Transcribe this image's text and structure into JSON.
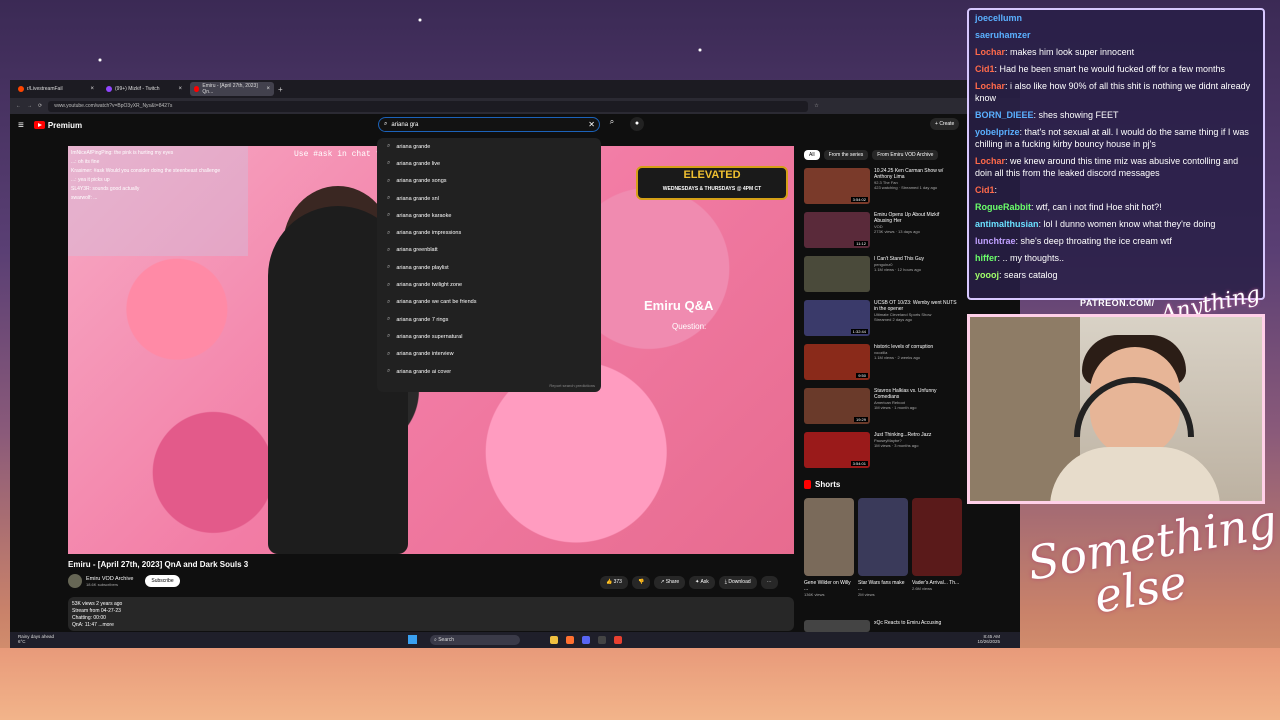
{
  "browser": {
    "tabs": [
      {
        "label": "r/LivestreamFail",
        "color": "#ff4500"
      },
      {
        "label": "(99+) Mizkif - Twitch",
        "color": "#9146ff"
      },
      {
        "label": "Emiru - [April 27th, 2023] Qn...",
        "color": "#ff0000",
        "active": true
      }
    ],
    "url": "www.youtube.com/watch?v=BpO3yXR_Nys&t=8427s"
  },
  "youtube": {
    "logo_text": "Premium",
    "search_value": "ariana gra",
    "create_label": "Create",
    "suggestions": [
      "ariana grande",
      "ariana grande live",
      "ariana grande songs",
      "ariana grande snl",
      "ariana grande karaoke",
      "ariana grande impressions",
      "ariana greenblatt",
      "ariana grande playlist",
      "ariana grande twilight zone",
      "ariana grande we cant be friends",
      "ariana grande 7 rings",
      "ariana grande supernatural",
      "ariana grande interview",
      "ariana grande ai cover"
    ],
    "report_label": "Report search predictions",
    "video": {
      "use_cmd_text": "Use #ask in chat t",
      "elevated_title": "ELEVATED",
      "elevated_sub": "WEDNESDAYS & THURSDAYS @ 4PM CT",
      "qa_title": "Emiru Q&A",
      "qa_question": "Question:",
      "chat_lines": [
        "ImNiceAfPingPing: the pink is hurting my eyes",
        "...: oh its fine",
        "Krasimer: #ask Would you consider doing the steenbeast challenge",
        "...: yea it picks up",
        "SL4Y3R: sounds good actually",
        "swarwolf: ..."
      ]
    },
    "title": "Emiru - [April 27th, 2023] QnA and Dark Souls 3",
    "channel": "Emiru VOD Archive",
    "subscribers": "18.6K subscribers",
    "subscribe_label": "Subscribe",
    "actions": {
      "likes": "373",
      "share": "Share",
      "ask": "Ask",
      "download": "Download"
    },
    "description": {
      "line1": "53K views  2 years ago",
      "line2": "Stream from 04-27-23",
      "line3": "Chatting: 00:00",
      "line4": "QnA: 11:47 ...more"
    },
    "chips": [
      "All",
      "From the series",
      "From Emiru VOD Archive"
    ],
    "related": [
      {
        "title": "10.24.25 Ken Carman Show w/ Anthony Lima",
        "channel": "92.3 The Fan",
        "meta": "423 watching · Streamed 1 day ago",
        "duration": "3:54:02",
        "thumb": "#7a3a2a"
      },
      {
        "title": "Emiru Opens Up About Mizkif Abusing Her",
        "channel": "VOD",
        "meta": "273K views · 13 days ago",
        "duration": "11:12",
        "thumb": "#5a2a3a"
      },
      {
        "title": "I Can't Stand This Guy",
        "channel": "penguinz0",
        "meta": "1.1M views · 12 hours ago",
        "duration": "",
        "thumb": "#4a4a3a"
      },
      {
        "title": "UCSB OT 10/23: Wemby went NUTS in the opener",
        "channel": "Ultimate Cleveland Sports Show",
        "meta": "Streamed 2 days ago",
        "duration": "1:32:44",
        "thumb": "#3a3a6a"
      },
      {
        "title": "historic levels of corruption",
        "channel": "voozilla",
        "meta": "1.1M views · 2 weeks ago",
        "duration": "9:50",
        "thumb": "#8a2a1a"
      },
      {
        "title": "Stavros Halkias vs. Unfunny Comedians",
        "channel": "American Reboot",
        "meta": "1M views · 1 month ago",
        "duration": "19:29",
        "thumb": "#6a3a2a"
      },
      {
        "title": "Just Thinking...Retro Jazz",
        "channel": "PauseyMaybe?",
        "meta": "1M views · 3 months ago",
        "duration": "3:54:01",
        "thumb": "#9a1a1a"
      }
    ],
    "shorts_header": "Shorts",
    "shorts": [
      {
        "title": "Gene Wilder on Willy ...",
        "views": "136K views",
        "color": "#7a6a5a"
      },
      {
        "title": "Star Wars fans make ...",
        "views": "2M views",
        "color": "#3a3a5a"
      },
      {
        "title": "Vader's Arrival... Th...",
        "views": "2.6M views",
        "color": "#5a1a1a"
      }
    ],
    "bottom_related": "xQc Reacts to Emiru Accusing"
  },
  "taskbar": {
    "weather_title": "Rainy days ahead",
    "weather_temp": "6°C",
    "search_label": "Search",
    "time": "8:45 AM",
    "date": "10/26/2025"
  },
  "chat": {
    "messages": [
      {
        "name": "joecellumn",
        "text": "",
        "color": "#5ab0ff"
      },
      {
        "name": "saeruhamzer",
        "text": "",
        "color": "#5ab0ff"
      },
      {
        "name": "Lochar",
        "text": ": makes him look super innocent",
        "color": "#ff6a4a"
      },
      {
        "name": "Cid1",
        "text": ": Had he been smart he would fucked off for a few months",
        "color": "#ff6a4a"
      },
      {
        "name": "Lochar",
        "text": ": i also like how 90% of all this shit is nothing we didnt already know",
        "color": "#ff6a4a"
      },
      {
        "name": "BORN_DIEEE",
        "text": ": shes showing FEET",
        "color": "#5ab0ff"
      },
      {
        "name": "yobelprize",
        "text": ": that's not sexual at all. I would do the same thing if I was chilling in a fucking kirby bouncy house in pj's",
        "color": "#5ab0ff"
      },
      {
        "name": "Lochar",
        "text": ": we knew around this time miz was abusive contolling and doin all this from the leaked discord messages",
        "color": "#ff6a4a"
      },
      {
        "name": "Cid1",
        "text": ":",
        "color": "#ff6a4a"
      },
      {
        "name": "RogueRabbit",
        "text": ": wtf, can i not find Hoe shit hot?!",
        "color": "#6aff6a"
      },
      {
        "name": "antimalthusian",
        "text": ": lol I dunno women know what they're doing",
        "color": "#6ae0ff"
      },
      {
        "name": "lunchtrae",
        "text": ": she's deep throating the ice cream wtf",
        "color": "#c0a0ff"
      },
      {
        "name": "hiffer",
        "text": ": .. my thoughts..",
        "color": "#6aff6a"
      },
      {
        "name": "yoooj",
        "text": ": sears catalog",
        "color": "#a0ff6a"
      }
    ]
  },
  "overlay": {
    "patreon_text": "PATREON.COM/",
    "anything_text": "Anything",
    "something_line1": "Something",
    "something_line2": "else"
  }
}
